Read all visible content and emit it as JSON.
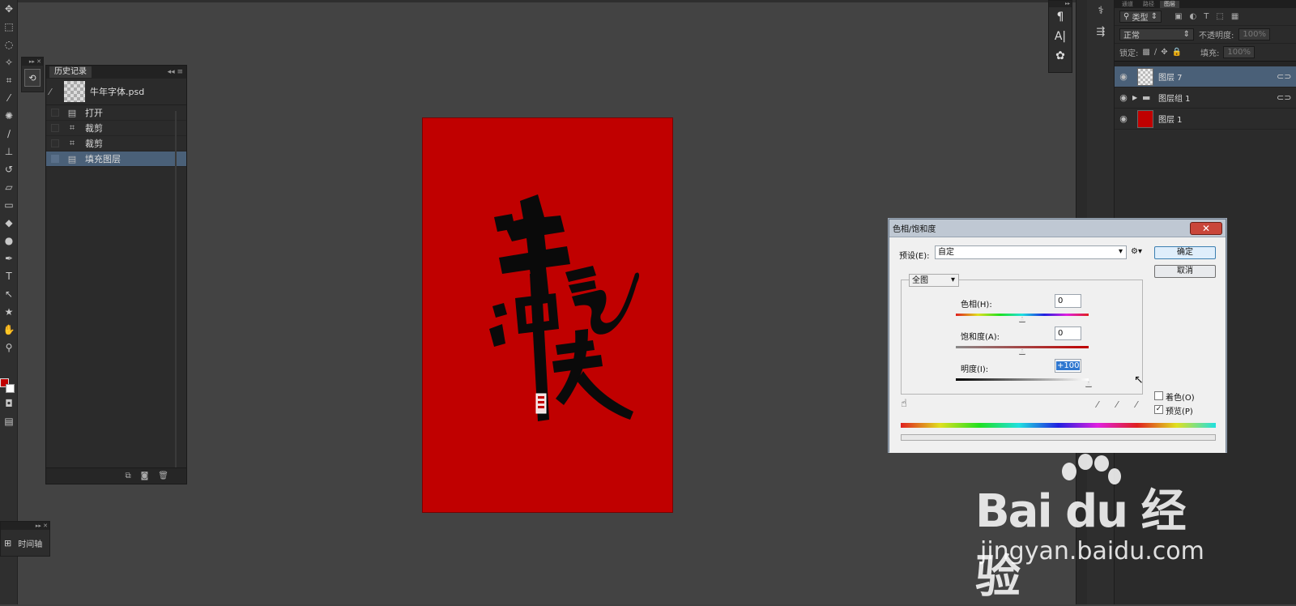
{
  "history_panel": {
    "title": "历史记录",
    "snapshot_name": "牛年字体.psd",
    "items": [
      {
        "label": "打开",
        "icon": "document-icon"
      },
      {
        "label": "裁剪",
        "icon": "crop-icon"
      },
      {
        "label": "裁剪",
        "icon": "crop-icon"
      },
      {
        "label": "填充图层",
        "icon": "document-icon",
        "active": true
      }
    ]
  },
  "timeline_panel": {
    "label": "时间轴"
  },
  "layers_panel": {
    "tabs": [
      "通道",
      "路径",
      "图层"
    ],
    "active_tab": "图层",
    "filter_kind": "类型",
    "blend_mode": "正常",
    "opacity_label": "不透明度:",
    "opacity_value": "100%",
    "lock_label": "锁定:",
    "fill_label": "填充:",
    "fill_value": "100%",
    "layers": [
      {
        "name": "图层 7",
        "type": "transparent",
        "active": true
      },
      {
        "name": "图层组 1",
        "type": "group"
      },
      {
        "name": "图层 1",
        "type": "red-fill"
      }
    ]
  },
  "dialog": {
    "title": "色相/饱和度",
    "preset_label": "预设(E):",
    "preset_value": "自定",
    "ok_label": "确定",
    "cancel_label": "取消",
    "channel_value": "全图",
    "hue_label": "色相(H):",
    "hue_value": "0",
    "hue_level": 0.5,
    "saturation_label": "饱和度(A):",
    "saturation_value": "0",
    "saturation_level": 0.5,
    "lightness_label": "明度(I):",
    "lightness_value": "+100",
    "lightness_level": 1.0,
    "colorize_label": "着色(O)",
    "colorize_checked": false,
    "preview_label": "预览(P)",
    "preview_checked": true
  },
  "canvas": {
    "fill_color": "#c00000"
  },
  "colors": {
    "foreground": "#c00000",
    "background": "#ffffff",
    "selection": "#4a6078"
  },
  "watermark": {
    "main": "Bai du 经验",
    "sub": "jingyan.baidu.com"
  }
}
